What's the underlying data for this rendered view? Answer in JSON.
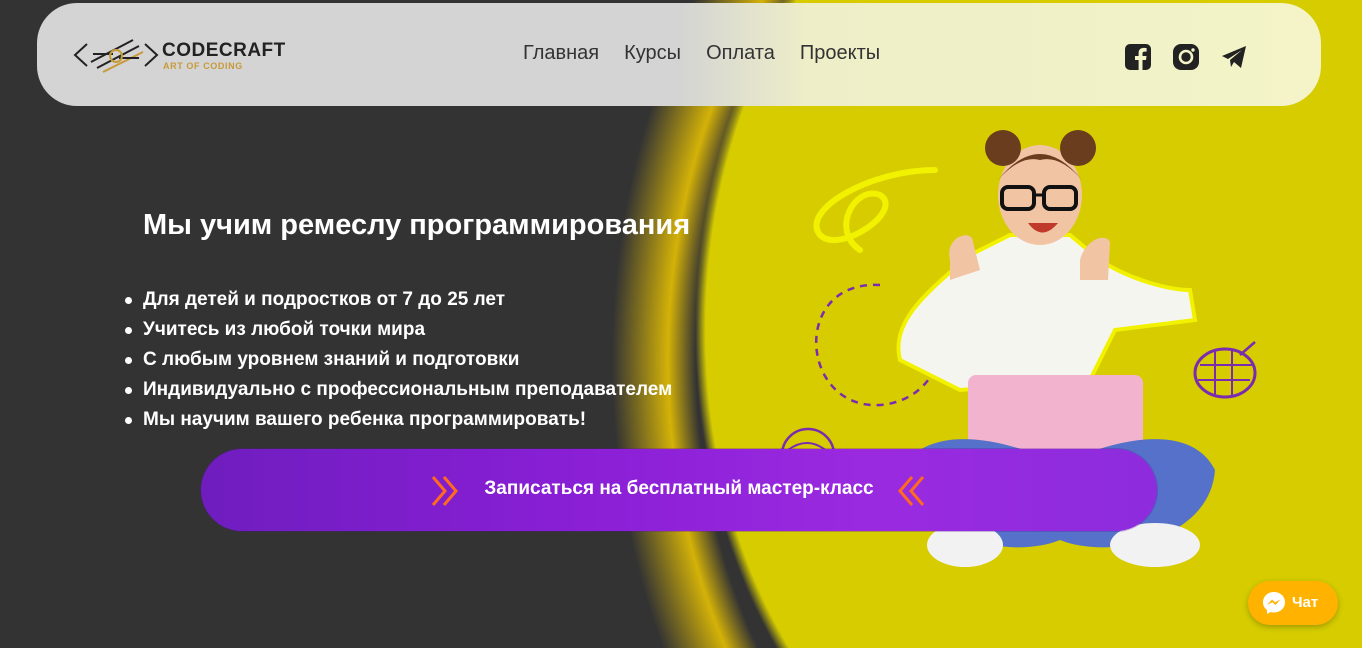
{
  "header": {
    "logo": {
      "title": "CODECRAFT",
      "subtitle": "ART OF CODING"
    },
    "nav": [
      {
        "label": "Главная"
      },
      {
        "label": "Курсы"
      },
      {
        "label": "Оплата"
      },
      {
        "label": "Проекты"
      }
    ],
    "social": [
      "facebook-icon",
      "instagram-icon",
      "telegram-icon"
    ]
  },
  "hero": {
    "title": "Мы учим ремеслу программирования",
    "features": [
      "Для детей и подростков от 7 до 25 лет",
      "Учитесь из любой точки мира",
      "С любым уровнем знаний и подготовки",
      "Индивидуально с профессиональным преподавателем",
      "Мы научим вашего ребенка программировать!"
    ],
    "cta": "Записаться на бесплатный мастер-класс"
  },
  "chat": {
    "label": "Чат"
  },
  "colors": {
    "dark_bg": "#333333",
    "yellow": "#d6cc00",
    "cta_purple": "#8a1fd6",
    "chat_orange": "#ffb300",
    "logo_accent": "#c79a3a"
  }
}
